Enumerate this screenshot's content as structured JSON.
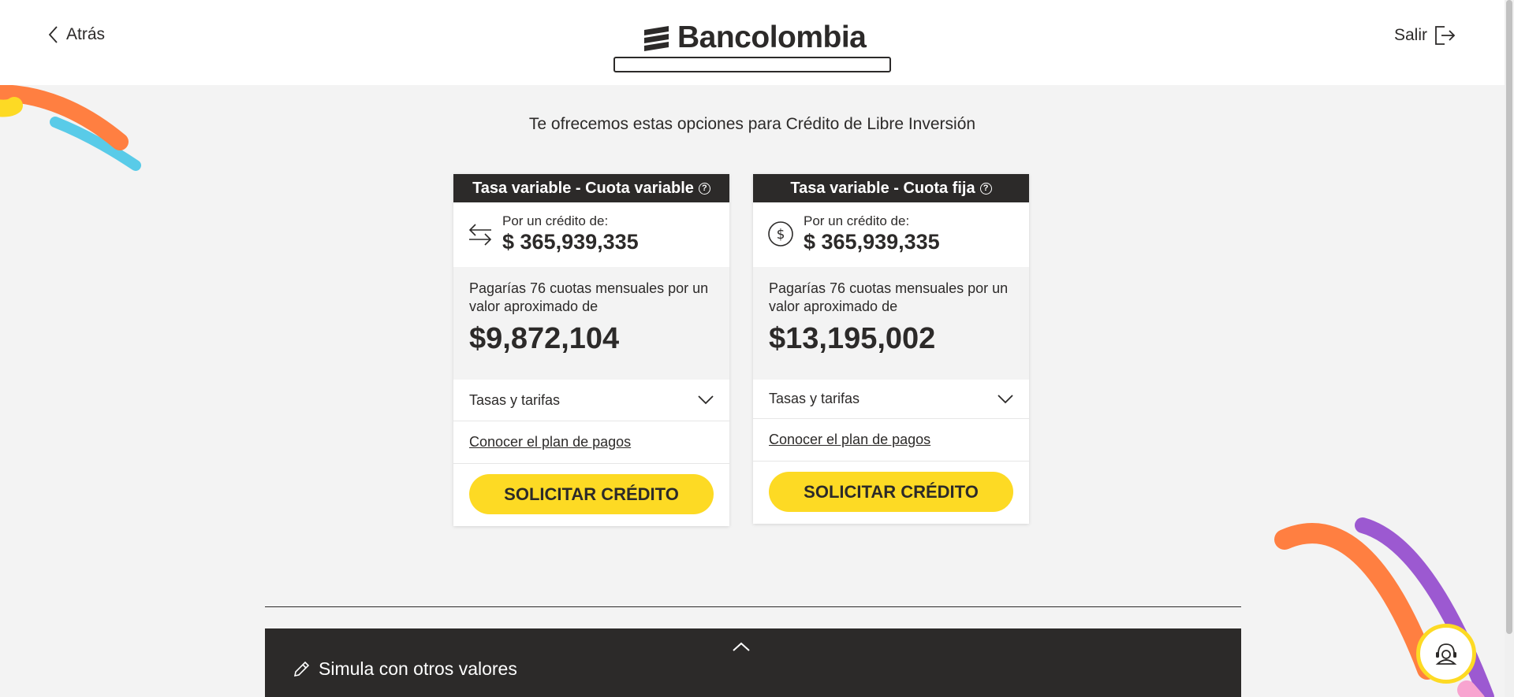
{
  "header": {
    "back_label": "Atrás",
    "brand": "Bancolombia",
    "exit_label": "Salir"
  },
  "intro": "Te ofrecemos estas opciones para Crédito de Libre Inversión",
  "cards": [
    {
      "title": "Tasa variable - Cuota variable",
      "amount_label": "Por un crédito de:",
      "amount": "$ 365,939,335",
      "quota_text": "Pagarías 76 cuotas mensuales por un valor aproximado de",
      "quota_value": "$9,872,104",
      "rates_label": "Tasas y tarifas",
      "plan_link": "Conocer el plan de pagos",
      "cta": "SOLICITAR CRÉDITO",
      "icon": "transfer-arrows-icon"
    },
    {
      "title": "Tasa variable - Cuota fija",
      "amount_label": "Por un crédito de:",
      "amount": "$ 365,939,335",
      "quota_text": "Pagarías 76 cuotas mensuales por un valor aproximado de",
      "quota_value": "$13,195,002",
      "rates_label": "Tasas y tarifas",
      "plan_link": "Conocer el plan de pagos",
      "cta": "SOLICITAR CRÉDITO",
      "icon": "dollar-circle-icon"
    }
  ],
  "bottom": {
    "simulate_label": "Simula con otros valores"
  },
  "colors": {
    "brand_yellow": "#fdda24",
    "dark": "#2c2a29",
    "background": "#f3f3f3",
    "deco_orange": "#ff7f41",
    "deco_blue": "#59cbe8",
    "deco_purple": "#9c59d1",
    "deco_pink": "#f8a4d0"
  }
}
